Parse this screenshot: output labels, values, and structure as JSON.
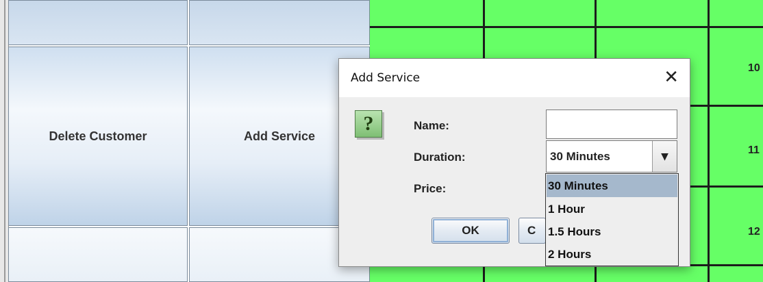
{
  "panel": {
    "delete_customer": "Delete Customer",
    "add_service": "Add Service"
  },
  "schedule": {
    "time_labels": [
      "10",
      "11",
      "12"
    ],
    "cell_color": "#66ff66"
  },
  "dialog": {
    "title": "Add Service",
    "close_glyph": "✕",
    "icon": "question-icon",
    "icon_glyph": "?",
    "name_label": "Name:",
    "name_value": "",
    "duration_label": "Duration:",
    "duration_value": "30 Minutes",
    "price_label": "Price:",
    "ok_label": "OK",
    "cancel_label_visible": "C"
  },
  "duration_dropdown": {
    "options": [
      "30 Minutes",
      "1 Hour",
      "1.5 Hours",
      "2 Hours"
    ],
    "selected": "30 Minutes"
  },
  "colors": {
    "grid_green": "#66ff66",
    "selected_option": "#a5b8cc"
  }
}
